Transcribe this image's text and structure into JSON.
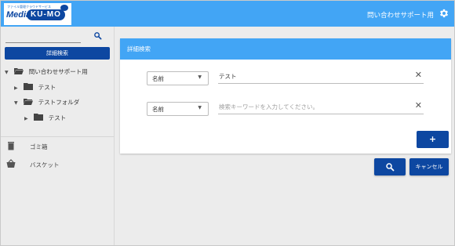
{
  "header": {
    "logo_tagline": "ファイル管理クラウドサービス",
    "logo_media": "Media",
    "logo_kumo": "KU-MO",
    "title": "問い合わせサポート用",
    "settings_icon": "gear-icon"
  },
  "sidebar": {
    "search_value": "",
    "advanced_search_label": "詳細検索",
    "tree": [
      {
        "label": "問い合わせサポート用",
        "caret": "▼",
        "icon": "folder-open-icon"
      },
      {
        "label": "テスト",
        "caret": "▶",
        "icon": "folder-icon"
      },
      {
        "label": "テストフォルダ",
        "caret": "▼",
        "icon": "folder-open-icon"
      },
      {
        "label": "テスト",
        "caret": "▶",
        "icon": "folder-icon"
      }
    ],
    "trash_label": "ゴミ箱",
    "basket_label": "バスケット"
  },
  "main": {
    "panel_title": "詳細検索",
    "rows": [
      {
        "field": "名前",
        "value": "テスト",
        "placeholder": ""
      },
      {
        "field": "名前",
        "value": "",
        "placeholder": "検索キーワードを入力してください。"
      }
    ],
    "add_label": "+",
    "cancel_label": "キャンセル"
  },
  "colors": {
    "header": "#42a5f5",
    "primary": "#0d47a1",
    "background": "#ececec"
  }
}
